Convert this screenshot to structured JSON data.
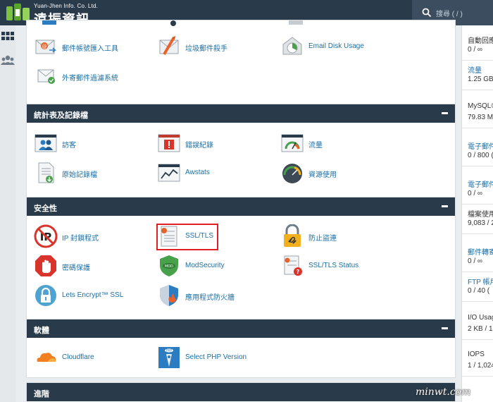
{
  "header": {
    "logo_sub": "Yuan-Jhen Info. Co. Ltd.",
    "logo_main": "遠振資訊",
    "search_placeholder": "搜尋 ( / )"
  },
  "sections": {
    "email": {
      "items": [
        {
          "label": "郵件帳號匯入工具",
          "icon": "email-import-icon"
        },
        {
          "label": "垃圾郵件殺手",
          "icon": "spam-killer-icon"
        },
        {
          "label": "Email Disk Usage",
          "icon": "email-disk-usage-icon"
        },
        {
          "label": "外寄郵件過濾系統",
          "icon": "outgoing-filter-icon"
        }
      ]
    },
    "stats": {
      "title": "統計表及記錄檔",
      "items": [
        {
          "label": "訪客",
          "icon": "visitors-icon"
        },
        {
          "label": "錯誤紀錄",
          "icon": "error-log-icon"
        },
        {
          "label": "流量",
          "icon": "bandwidth-icon"
        },
        {
          "label": "原始記錄檔",
          "icon": "raw-log-icon"
        },
        {
          "label": "Awstats",
          "icon": "awstats-icon"
        },
        {
          "label": "資源使用",
          "icon": "resource-usage-icon"
        }
      ]
    },
    "security": {
      "title": "安全性",
      "items": [
        {
          "label": "IP 封鎖程式",
          "icon": "ip-blocker-icon"
        },
        {
          "label": "SSL/TLS",
          "icon": "ssl-tls-icon"
        },
        {
          "label": "防止盜連",
          "icon": "hotlink-protection-icon"
        },
        {
          "label": "密碼保護",
          "icon": "password-protect-icon"
        },
        {
          "label": "ModSecurity",
          "icon": "modsecurity-icon"
        },
        {
          "label": "SSL/TLS Status",
          "icon": "ssl-status-icon"
        },
        {
          "label": "Lets Encrypt™ SSL",
          "icon": "lets-encrypt-icon"
        },
        {
          "label": "應用程式防火牆",
          "icon": "app-firewall-icon"
        }
      ]
    },
    "software": {
      "title": "軟體",
      "items": [
        {
          "label": "Cloudflare",
          "icon": "cloudflare-icon"
        },
        {
          "label": "Select PHP Version",
          "icon": "php-version-icon"
        }
      ]
    },
    "advanced": {
      "title": "進階"
    }
  },
  "sidebar_stats": [
    {
      "label": "自動回應",
      "value": "0 / ∞",
      "link": false
    },
    {
      "label": "流量",
      "value": "1.25 GB",
      "link": true
    },
    {
      "label": "MySQL®",
      "value": "79.83 M",
      "link": false
    },
    {
      "label": "電子郵件",
      "value": "0 / 800 (",
      "link": true
    },
    {
      "label": "電子郵件",
      "value": "0 / ∞",
      "link": true
    },
    {
      "label": "檔案使用",
      "value": "9,083 / 2",
      "link": false
    },
    {
      "label": "郵件轉寄",
      "value": "0 / ∞",
      "link": true
    },
    {
      "label": "FTP 帳戶",
      "value": "0 / 40 (",
      "link": true
    },
    {
      "label": "I/O Usag",
      "value": "2 KB / 1",
      "link": false
    },
    {
      "label": "IOPS",
      "value": "1 / 1,024",
      "link": false
    }
  ],
  "watermark": "minwt.com",
  "colors": {
    "header_bg": "#293a4a",
    "link": "#1c6ea4",
    "highlight": "#e02020"
  }
}
